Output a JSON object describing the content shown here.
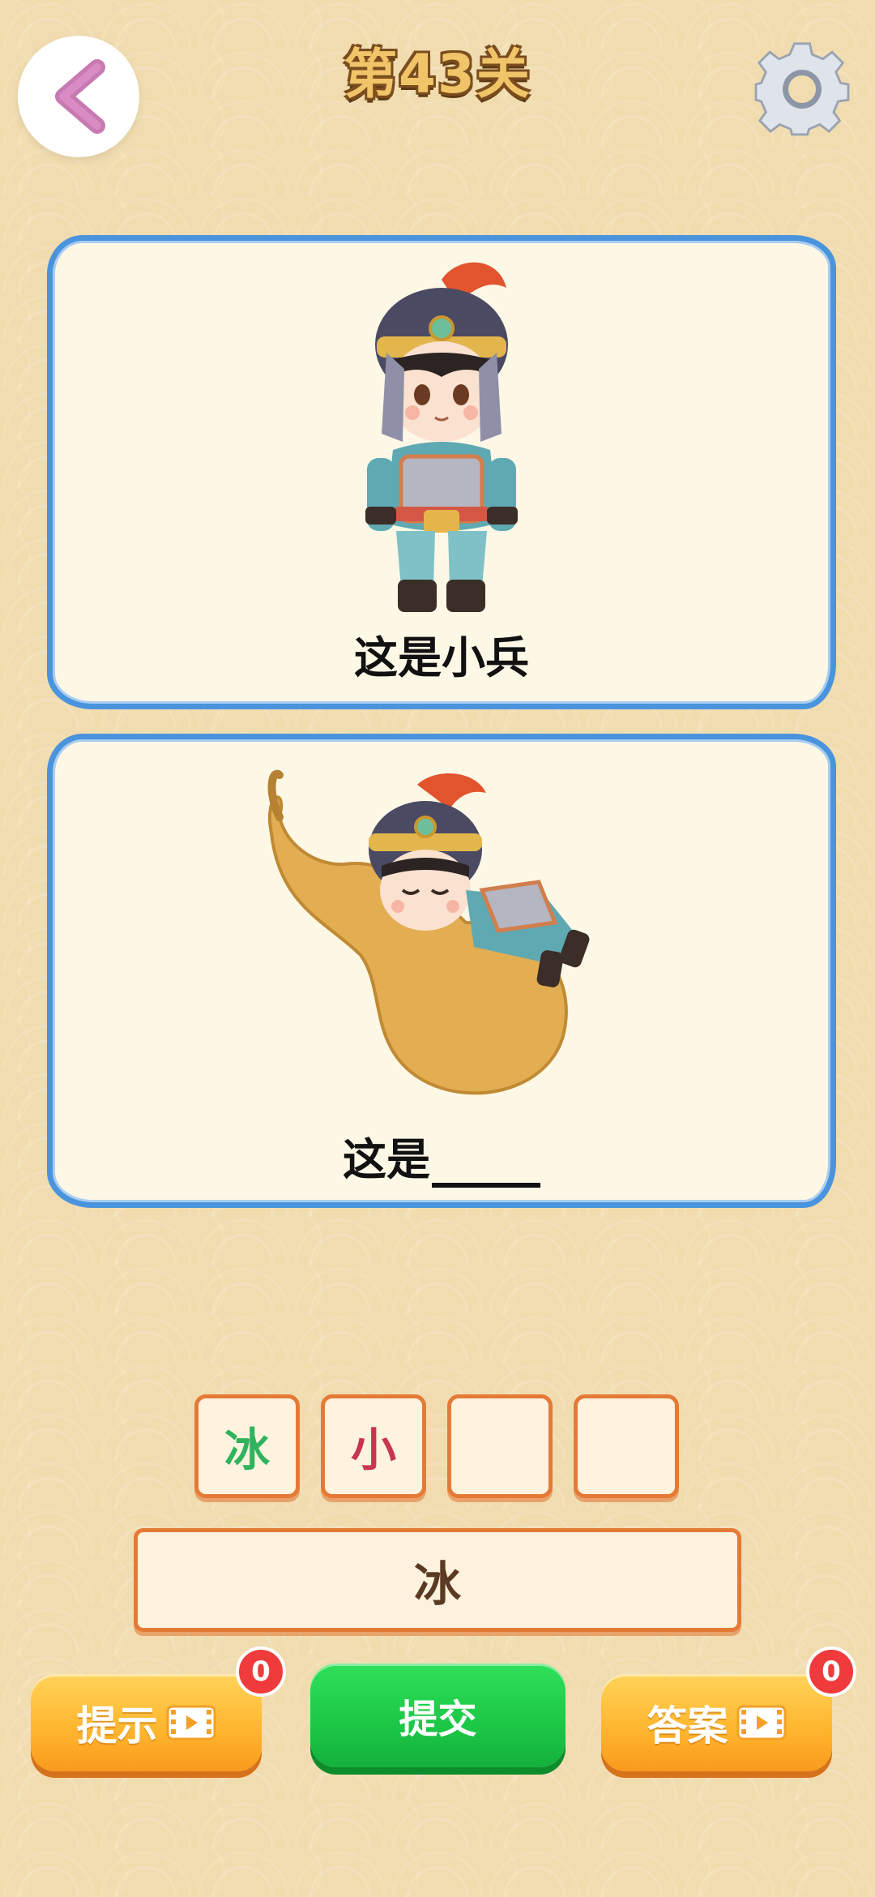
{
  "header": {
    "title": "第43关",
    "back_icon": "chevron-left-icon",
    "settings_icon": "gear-icon"
  },
  "cards": [
    {
      "caption": "这是小兵",
      "image": "cartoon-soldier"
    },
    {
      "caption_prefix": "这是",
      "image": "soldier-sleeping-on-gourd"
    }
  ],
  "answer_slots": [
    {
      "char": "冰",
      "color": "#2fb35c"
    },
    {
      "char": "小",
      "color": "#c8354d"
    },
    {
      "char": ""
    },
    {
      "char": ""
    }
  ],
  "candidates": [
    "冰"
  ],
  "buttons": {
    "hint_label": "提示",
    "hint_count": "0",
    "submit_label": "提交",
    "answer_label": "答案",
    "answer_count": "0"
  },
  "colors": {
    "background": "#f1dcaf",
    "card_border": "#4a93dd",
    "slot_border": "#e57a37",
    "submit_green": "#1cc746",
    "orange": "#ffb42c",
    "badge_red": "#ef3b3b"
  }
}
